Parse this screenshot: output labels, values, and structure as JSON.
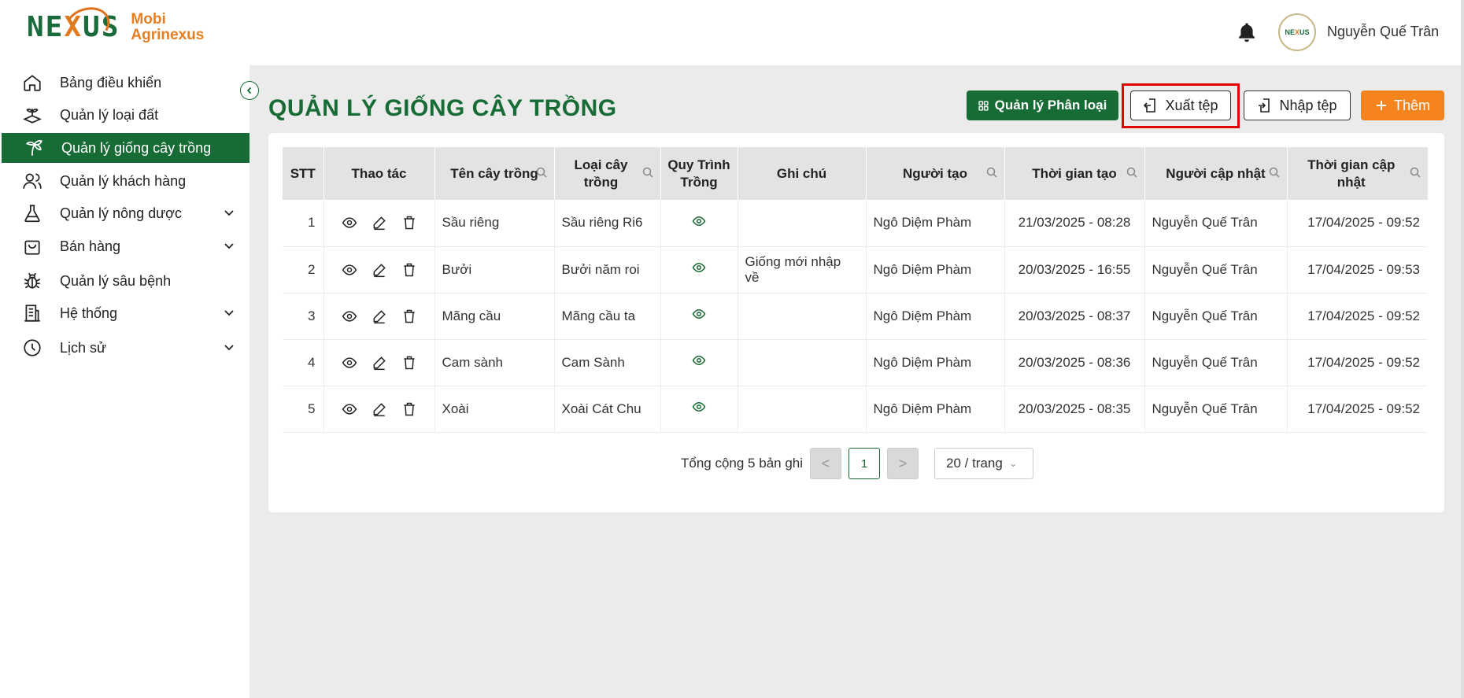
{
  "header": {
    "logo_text": "NEXUS",
    "brand_line1": "Mobi",
    "brand_line2": "Agrinexus",
    "avatar_text": "NEXUS",
    "username": "Nguyễn Quế Trân",
    "notification_icon": "bell-icon"
  },
  "sidebar": {
    "items": [
      {
        "label": "Bảng điều khiển",
        "icon": "home-icon"
      },
      {
        "label": "Quản lý loại đất",
        "icon": "soil-icon"
      },
      {
        "label": "Quản lý giống cây trồng",
        "icon": "plant-icon",
        "active": true
      },
      {
        "label": "Quản lý khách hàng",
        "icon": "users-icon"
      },
      {
        "label": "Quản lý nông dược",
        "icon": "flask-icon",
        "expandable": true
      },
      {
        "label": "Bán hàng",
        "icon": "bag-icon",
        "expandable": true
      },
      {
        "label": "Quản lý sâu bệnh",
        "icon": "bug-icon"
      },
      {
        "label": "Hệ thống",
        "icon": "building-icon",
        "expandable": true
      },
      {
        "label": "Lịch sử",
        "icon": "clock-icon",
        "expandable": true
      }
    ]
  },
  "main": {
    "title": "QUẢN LÝ GIỐNG CÂY TRỒNG",
    "buttons": {
      "categories": "Quản lý Phân loại",
      "export": "Xuất tệp",
      "import": "Nhập tệp",
      "add": "Thêm"
    },
    "table": {
      "headers": {
        "stt": "STT",
        "actions": "Thao tác",
        "name": "Tên cây trồng",
        "type": "Loại cây trồng",
        "process": "Quy Trình Trồng",
        "note": "Ghi chú",
        "creator": "Người tạo",
        "created": "Thời gian tạo",
        "updater": "Người cập nhật",
        "updated": "Thời gian cập nhật"
      },
      "rows": [
        {
          "stt": "1",
          "name": "Sầu riêng",
          "type": "Sầu riêng Ri6",
          "note": "",
          "creator": "Ngô Diệm Phàm",
          "created": "21/03/2025 - 08:28",
          "updater": "Nguyễn Quế Trân",
          "updated": "17/04/2025 - 09:52"
        },
        {
          "stt": "2",
          "name": "Bưởi",
          "type": "Bưởi năm roi",
          "note": "Giống mới nhập về",
          "creator": "Ngô Diệm Phàm",
          "created": "20/03/2025 - 16:55",
          "updater": "Nguyễn Quế Trân",
          "updated": "17/04/2025 - 09:53"
        },
        {
          "stt": "3",
          "name": "Mãng cầu",
          "type": "Mãng cầu ta",
          "note": "",
          "creator": "Ngô Diệm Phàm",
          "created": "20/03/2025 - 08:37",
          "updater": "Nguyễn Quế Trân",
          "updated": "17/04/2025 - 09:52"
        },
        {
          "stt": "4",
          "name": "Cam sành",
          "type": "Cam Sành",
          "note": "",
          "creator": "Ngô Diệm Phàm",
          "created": "20/03/2025 - 08:36",
          "updater": "Nguyễn Quế Trân",
          "updated": "17/04/2025 - 09:52"
        },
        {
          "stt": "5",
          "name": "Xoài",
          "type": "Xoài Cát Chu",
          "note": "",
          "creator": "Ngô Diệm Phàm",
          "created": "20/03/2025 - 08:35",
          "updater": "Nguyễn Quế Trân",
          "updated": "17/04/2025 - 09:52"
        }
      ]
    },
    "pagination": {
      "total": "Tổng cộng 5 bản ghi",
      "current_page": "1",
      "page_size": "20 / trang",
      "prev": "<",
      "next": ">"
    }
  },
  "colors": {
    "primary": "#176b35",
    "accent": "#f5841f",
    "highlight": "#e00000"
  }
}
